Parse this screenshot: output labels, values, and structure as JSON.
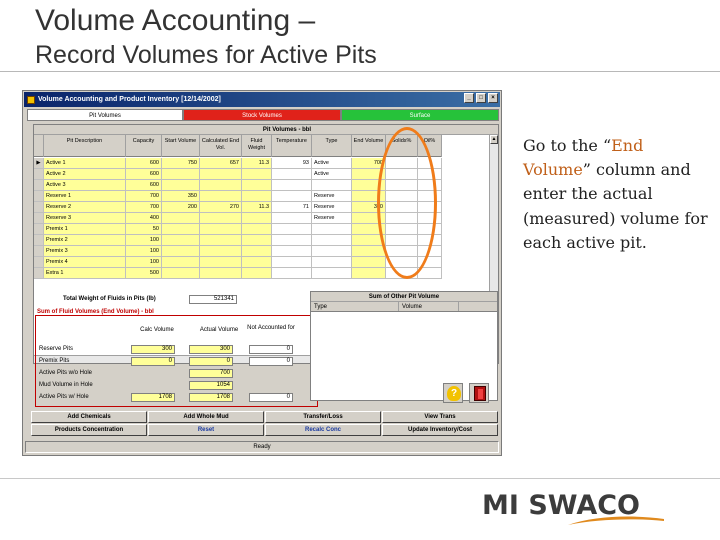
{
  "slide": {
    "title_line1": "Volume Accounting –",
    "title_line2": "Record Volumes for Active Pits",
    "instruction": {
      "before": "Go to the “",
      "highlight": "End Volume",
      "after": "” column and enter the actual (measured) volume for each active pit."
    },
    "logo_text": "MI SWACO",
    "accent_color": "#c0601a",
    "ring_color": "#f07c1a"
  },
  "window": {
    "title": "Volume Accounting and Product Inventory [12/14/2002]",
    "buttons": [
      "_",
      "□",
      "×"
    ],
    "tabs": [
      "Pit Volumes",
      "Stock Volumes",
      "Surface"
    ]
  },
  "pit_grid": {
    "banner": "Pit Volumes - bbl",
    "columns": [
      "Pit Description",
      "Capacity",
      "Start Volume",
      "Calculated End Vol.",
      "Fluid Weight",
      "Temperature",
      "Type",
      "End Volume",
      "Solids%",
      "Oil%"
    ],
    "rows": [
      [
        "Active 1",
        "600",
        "750",
        "657",
        "11.3",
        "93",
        "Active",
        "700",
        "",
        ""
      ],
      [
        "Active 2",
        "600",
        "",
        "",
        "",
        "",
        "Active",
        "",
        "",
        ""
      ],
      [
        "Active 3",
        "600",
        "",
        "",
        "",
        "",
        "",
        "",
        "",
        ""
      ],
      [
        "Reserve 1",
        "700",
        "350",
        "",
        "",
        "",
        "Reserve",
        "",
        "",
        ""
      ],
      [
        "Reserve 2",
        "700",
        "200",
        "270",
        "11.3",
        "71",
        "Reserve",
        "300",
        "",
        ""
      ],
      [
        "Reserve 3",
        "400",
        "",
        "",
        "",
        "",
        "Reserve",
        "",
        "",
        ""
      ],
      [
        "Premix 1",
        "50",
        "",
        "",
        "",
        "",
        "",
        "",
        "",
        ""
      ],
      [
        "Premix 2",
        "100",
        "",
        "",
        "",
        "",
        "",
        "",
        "",
        ""
      ],
      [
        "Premix 3",
        "100",
        "",
        "",
        "",
        "",
        "",
        "",
        "",
        ""
      ],
      [
        "Premix 4",
        "100",
        "",
        "",
        "",
        "",
        "",
        "",
        "",
        ""
      ],
      [
        "Extra 1",
        "500",
        "",
        "",
        "",
        "",
        "",
        "",
        "",
        ""
      ]
    ]
  },
  "fluids": {
    "total_weight_label": "Total Weight of Fluids in Pits (lb)",
    "total_weight_value": "521341",
    "sum_label": "Sum of Fluid Volumes (End Volume) - bbl",
    "col_calc": "Calc Volume",
    "col_actual": "Actual Volume",
    "col_not_accounted": "Not Accounted for",
    "rows": [
      {
        "label": "Reserve Pits",
        "calc": "300",
        "actual": "300",
        "diff": "0"
      },
      {
        "label": "Premix Pits",
        "calc": "0",
        "actual": "0",
        "diff": "0"
      },
      {
        "label": "Active Pits w/o Hole",
        "calc": "",
        "actual": "700",
        "diff": ""
      },
      {
        "label": "Mud Volume in Hole",
        "calc": "",
        "actual": "1054",
        "diff": ""
      },
      {
        "label": "Active Pits w/ Hole",
        "calc": "1708",
        "actual": "1708",
        "diff": "0"
      }
    ]
  },
  "other_grid": {
    "banner": "Sum of Other Pit Volume",
    "columns": [
      "Type",
      "Volume"
    ]
  },
  "actions": {
    "row1": [
      "Add Chemicals",
      "Add Whole Mud",
      "Transfer/Loss",
      "View Trans"
    ],
    "row2": [
      "Products Concentration",
      "Reset",
      "Recalc Conc",
      "Update Inventory/Cost"
    ]
  },
  "status": "Ready"
}
